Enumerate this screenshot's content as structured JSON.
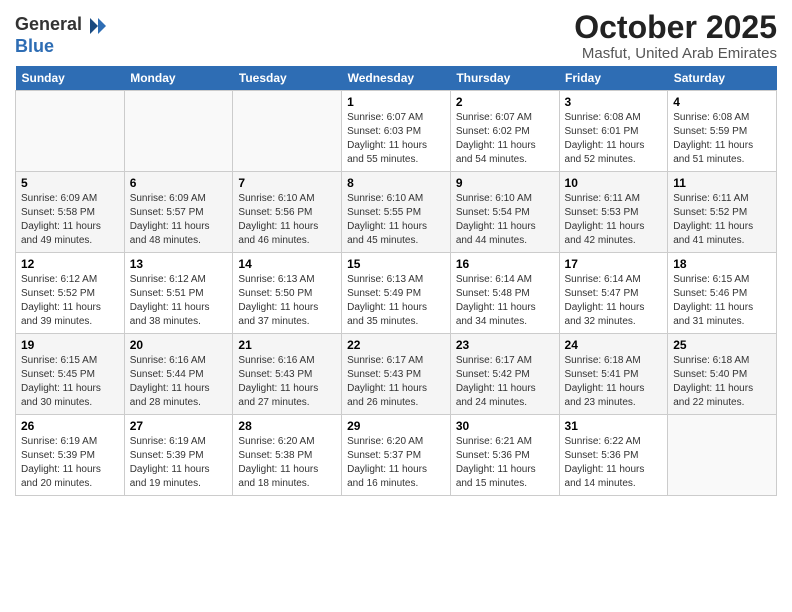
{
  "header": {
    "logo_general": "General",
    "logo_blue": "Blue",
    "month_title": "October 2025",
    "location": "Masfut, United Arab Emirates"
  },
  "weekdays": [
    "Sunday",
    "Monday",
    "Tuesday",
    "Wednesday",
    "Thursday",
    "Friday",
    "Saturday"
  ],
  "weeks": [
    [
      {
        "day": "",
        "info": ""
      },
      {
        "day": "",
        "info": ""
      },
      {
        "day": "",
        "info": ""
      },
      {
        "day": "1",
        "info": "Sunrise: 6:07 AM\nSunset: 6:03 PM\nDaylight: 11 hours\nand 55 minutes."
      },
      {
        "day": "2",
        "info": "Sunrise: 6:07 AM\nSunset: 6:02 PM\nDaylight: 11 hours\nand 54 minutes."
      },
      {
        "day": "3",
        "info": "Sunrise: 6:08 AM\nSunset: 6:01 PM\nDaylight: 11 hours\nand 52 minutes."
      },
      {
        "day": "4",
        "info": "Sunrise: 6:08 AM\nSunset: 5:59 PM\nDaylight: 11 hours\nand 51 minutes."
      }
    ],
    [
      {
        "day": "5",
        "info": "Sunrise: 6:09 AM\nSunset: 5:58 PM\nDaylight: 11 hours\nand 49 minutes."
      },
      {
        "day": "6",
        "info": "Sunrise: 6:09 AM\nSunset: 5:57 PM\nDaylight: 11 hours\nand 48 minutes."
      },
      {
        "day": "7",
        "info": "Sunrise: 6:10 AM\nSunset: 5:56 PM\nDaylight: 11 hours\nand 46 minutes."
      },
      {
        "day": "8",
        "info": "Sunrise: 6:10 AM\nSunset: 5:55 PM\nDaylight: 11 hours\nand 45 minutes."
      },
      {
        "day": "9",
        "info": "Sunrise: 6:10 AM\nSunset: 5:54 PM\nDaylight: 11 hours\nand 44 minutes."
      },
      {
        "day": "10",
        "info": "Sunrise: 6:11 AM\nSunset: 5:53 PM\nDaylight: 11 hours\nand 42 minutes."
      },
      {
        "day": "11",
        "info": "Sunrise: 6:11 AM\nSunset: 5:52 PM\nDaylight: 11 hours\nand 41 minutes."
      }
    ],
    [
      {
        "day": "12",
        "info": "Sunrise: 6:12 AM\nSunset: 5:52 PM\nDaylight: 11 hours\nand 39 minutes."
      },
      {
        "day": "13",
        "info": "Sunrise: 6:12 AM\nSunset: 5:51 PM\nDaylight: 11 hours\nand 38 minutes."
      },
      {
        "day": "14",
        "info": "Sunrise: 6:13 AM\nSunset: 5:50 PM\nDaylight: 11 hours\nand 37 minutes."
      },
      {
        "day": "15",
        "info": "Sunrise: 6:13 AM\nSunset: 5:49 PM\nDaylight: 11 hours\nand 35 minutes."
      },
      {
        "day": "16",
        "info": "Sunrise: 6:14 AM\nSunset: 5:48 PM\nDaylight: 11 hours\nand 34 minutes."
      },
      {
        "day": "17",
        "info": "Sunrise: 6:14 AM\nSunset: 5:47 PM\nDaylight: 11 hours\nand 32 minutes."
      },
      {
        "day": "18",
        "info": "Sunrise: 6:15 AM\nSunset: 5:46 PM\nDaylight: 11 hours\nand 31 minutes."
      }
    ],
    [
      {
        "day": "19",
        "info": "Sunrise: 6:15 AM\nSunset: 5:45 PM\nDaylight: 11 hours\nand 30 minutes."
      },
      {
        "day": "20",
        "info": "Sunrise: 6:16 AM\nSunset: 5:44 PM\nDaylight: 11 hours\nand 28 minutes."
      },
      {
        "day": "21",
        "info": "Sunrise: 6:16 AM\nSunset: 5:43 PM\nDaylight: 11 hours\nand 27 minutes."
      },
      {
        "day": "22",
        "info": "Sunrise: 6:17 AM\nSunset: 5:43 PM\nDaylight: 11 hours\nand 26 minutes."
      },
      {
        "day": "23",
        "info": "Sunrise: 6:17 AM\nSunset: 5:42 PM\nDaylight: 11 hours\nand 24 minutes."
      },
      {
        "day": "24",
        "info": "Sunrise: 6:18 AM\nSunset: 5:41 PM\nDaylight: 11 hours\nand 23 minutes."
      },
      {
        "day": "25",
        "info": "Sunrise: 6:18 AM\nSunset: 5:40 PM\nDaylight: 11 hours\nand 22 minutes."
      }
    ],
    [
      {
        "day": "26",
        "info": "Sunrise: 6:19 AM\nSunset: 5:39 PM\nDaylight: 11 hours\nand 20 minutes."
      },
      {
        "day": "27",
        "info": "Sunrise: 6:19 AM\nSunset: 5:39 PM\nDaylight: 11 hours\nand 19 minutes."
      },
      {
        "day": "28",
        "info": "Sunrise: 6:20 AM\nSunset: 5:38 PM\nDaylight: 11 hours\nand 18 minutes."
      },
      {
        "day": "29",
        "info": "Sunrise: 6:20 AM\nSunset: 5:37 PM\nDaylight: 11 hours\nand 16 minutes."
      },
      {
        "day": "30",
        "info": "Sunrise: 6:21 AM\nSunset: 5:36 PM\nDaylight: 11 hours\nand 15 minutes."
      },
      {
        "day": "31",
        "info": "Sunrise: 6:22 AM\nSunset: 5:36 PM\nDaylight: 11 hours\nand 14 minutes."
      },
      {
        "day": "",
        "info": ""
      }
    ]
  ]
}
